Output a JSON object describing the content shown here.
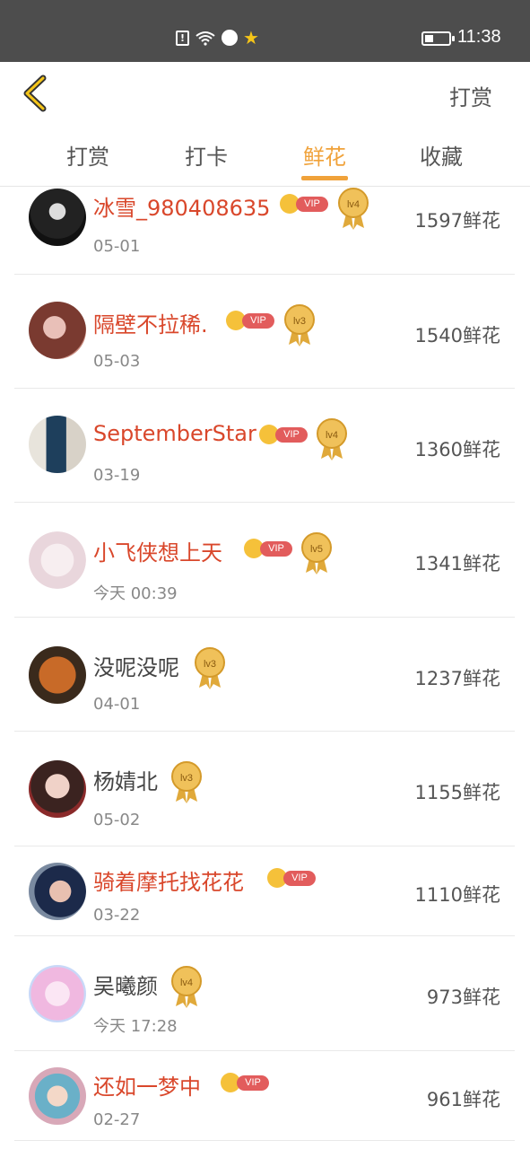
{
  "status_bar": {
    "time": "11:38"
  },
  "header": {
    "right_label": "打赏"
  },
  "tabs": [
    {
      "label": "打赏"
    },
    {
      "label": "打卡"
    },
    {
      "label": "鲜花",
      "active": true
    },
    {
      "label": "收藏"
    }
  ],
  "colors": {
    "accent": "#f0a23a",
    "vip_name": "#d9472b",
    "vip_tag": "#e25c5c",
    "status_bar": "#4d4d4d"
  },
  "rows": [
    {
      "name": "冰雪_980408635",
      "date": "05-01",
      "count": "1597鲜花",
      "vip": true,
      "vip_label": "VIP",
      "level": "lv4"
    },
    {
      "name": "隔壁不拉稀.",
      "date": "05-03",
      "count": "1540鲜花",
      "vip": true,
      "vip_label": "VIP",
      "level": "lv3"
    },
    {
      "name": "SeptemberStar",
      "date": "03-19",
      "count": "1360鲜花",
      "vip": true,
      "vip_label": "VIP",
      "level": "lv4"
    },
    {
      "name": "小飞侠想上天",
      "date": "今天 00:39",
      "count": "1341鲜花",
      "vip": true,
      "vip_label": "VIP",
      "level": "lv5"
    },
    {
      "name": "没呢没呢",
      "date": "04-01",
      "count": "1237鲜花",
      "vip": false,
      "level": "lv3"
    },
    {
      "name": "杨婧北",
      "date": "05-02",
      "count": "1155鲜花",
      "vip": false,
      "level": "lv3"
    },
    {
      "name": "骑着摩托找花花",
      "date": "03-22",
      "count": "1110鲜花",
      "vip": true,
      "vip_label": "VIP",
      "level": ""
    },
    {
      "name": "吴曦颜",
      "date": "今天 17:28",
      "count": "973鲜花",
      "vip": false,
      "level": "lv4"
    },
    {
      "name": "还如一梦中",
      "date": "02-27",
      "count": "961鲜花",
      "vip": true,
      "vip_label": "VIP",
      "level": ""
    }
  ]
}
